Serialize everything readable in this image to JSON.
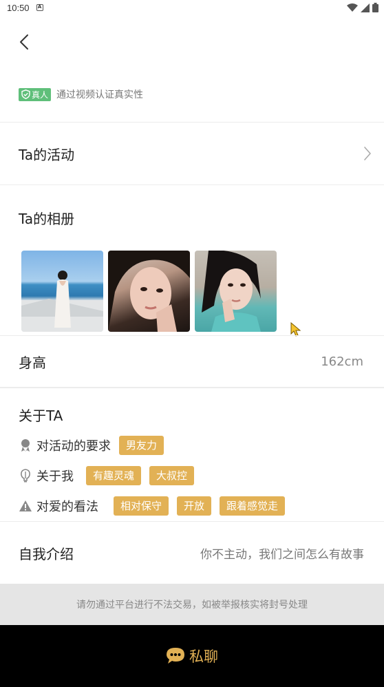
{
  "status_bar": {
    "time": "10:50",
    "notification_glyph": "A"
  },
  "verification": {
    "badge_label": "真人",
    "text": "通过视频认证真实性"
  },
  "activities": {
    "title": "Ta的活动"
  },
  "album": {
    "title": "Ta的相册",
    "photos": [
      "photo-yacht",
      "photo-selfie-1",
      "photo-selfie-2"
    ]
  },
  "height": {
    "label": "身高",
    "value": "162cm"
  },
  "about": {
    "title": "关于TA",
    "rows": [
      {
        "label": "对活动的要求",
        "icon": "award-icon",
        "tags": [
          "男友力"
        ]
      },
      {
        "label": "关于我",
        "icon": "bulb-icon",
        "tags": [
          "有趣灵魂",
          "大叔控"
        ]
      },
      {
        "label": "对爱的看法",
        "icon": "warning-icon",
        "tags": [
          "相对保守",
          "开放",
          "跟着感觉走"
        ]
      }
    ]
  },
  "intro": {
    "label": "自我介绍",
    "value": "你不主动，我们之间怎么有故事"
  },
  "warning": {
    "text": "请勿通过平台进行不法交易，如被举报核实将封号处理"
  },
  "chat": {
    "label": "私聊"
  },
  "colors": {
    "accent": "#e2b155",
    "verify_green": "#5fbf7a",
    "bottom_bar": "#000000"
  }
}
